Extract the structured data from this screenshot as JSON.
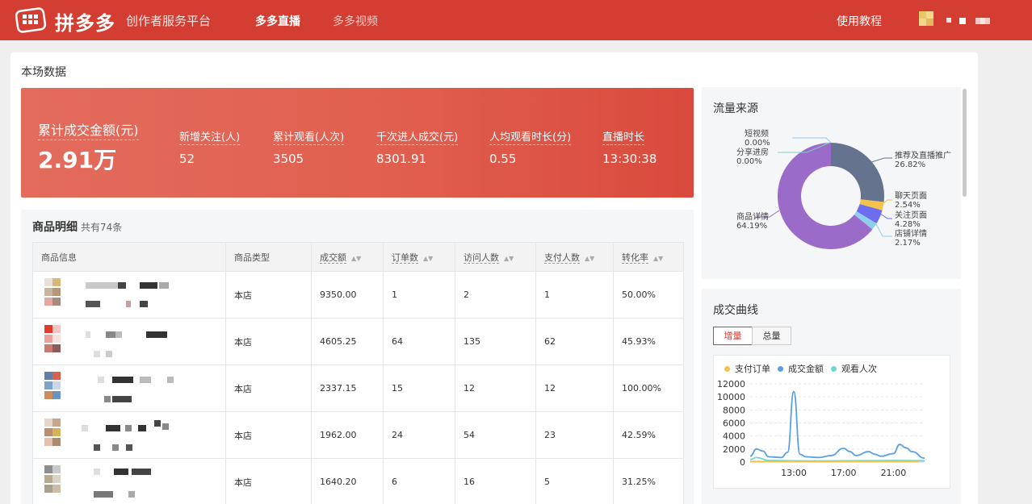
{
  "header": {
    "logo_text": "拼多多",
    "platform_name": "创作者服务平台",
    "nav": [
      {
        "label": "多多直播",
        "active": true
      },
      {
        "label": "多多视频",
        "active": false
      }
    ],
    "help_label": "使用教程",
    "icons": {
      "logo": "pinduoduo-logo-icon",
      "avatar": "user-avatar-icon"
    },
    "colors": {
      "brand": "#d43d32"
    }
  },
  "live_data": {
    "title": "本场数据",
    "total": {
      "label": "累计成交金额(元)",
      "value": "2.91万"
    },
    "metrics": [
      {
        "label": "新增关注(人)",
        "value": "52"
      },
      {
        "label": "累计观看(人次)",
        "value": "3505"
      },
      {
        "label": "千次进人成交(元)",
        "value": "8301.91"
      },
      {
        "label": "人均观看时长(分)",
        "value": "0.55"
      },
      {
        "label": "直播时长",
        "value": "13:30:38"
      }
    ]
  },
  "products": {
    "title": "商品明细",
    "count_text": "共有74条",
    "columns": [
      "商品信息",
      "商品类型",
      "成交额",
      "订单数",
      "访问人数",
      "支付人数",
      "转化率"
    ],
    "rows": [
      {
        "type": "本店",
        "amount": "9350.00",
        "orders": "1",
        "visitors": "2",
        "payers": "1",
        "rate": "50.00%"
      },
      {
        "type": "本店",
        "amount": "4605.25",
        "orders": "64",
        "visitors": "135",
        "payers": "62",
        "rate": "45.93%"
      },
      {
        "type": "本店",
        "amount": "2337.15",
        "orders": "15",
        "visitors": "12",
        "payers": "12",
        "rate": "100.00%"
      },
      {
        "type": "本店",
        "amount": "1962.00",
        "orders": "24",
        "visitors": "54",
        "payers": "23",
        "rate": "42.59%"
      },
      {
        "type": "本店",
        "amount": "1640.20",
        "orders": "6",
        "visitors": "16",
        "payers": "5",
        "rate": "31.25%"
      }
    ]
  },
  "traffic": {
    "title": "流量来源",
    "labels": {
      "short_video": {
        "name": "短视频",
        "pct": "0.00%"
      },
      "share": {
        "name": "分享进房",
        "pct": "0.00%"
      },
      "recommend": {
        "name": "推荐及直播推广",
        "pct": "26.82%"
      },
      "chat": {
        "name": "聊天页面",
        "pct": "2.54%"
      },
      "follow": {
        "name": "关注页面",
        "pct": "4.28%"
      },
      "shop": {
        "name": "店铺详情",
        "pct": "2.17%"
      },
      "product": {
        "name": "商品详情",
        "pct": "64.19%"
      }
    }
  },
  "curve": {
    "title": "成交曲线",
    "tabs": [
      {
        "label": "增量",
        "active": true
      },
      {
        "label": "总量",
        "active": false
      }
    ]
  },
  "chart_data": [
    {
      "type": "pie",
      "title": "流量来源",
      "donut": true,
      "slices": [
        {
          "name": "短视频",
          "value": 0.0,
          "color": "#9ec7e8"
        },
        {
          "name": "分享进房",
          "value": 0.0,
          "color": "#7fd3b6"
        },
        {
          "name": "推荐及直播推广",
          "value": 26.82,
          "color": "#66738f"
        },
        {
          "name": "聊天页面",
          "value": 2.54,
          "color": "#f5c24c"
        },
        {
          "name": "关注页面",
          "value": 4.28,
          "color": "#6d6df0"
        },
        {
          "name": "店铺详情",
          "value": 2.17,
          "color": "#8ecff0"
        },
        {
          "name": "商品详情",
          "value": 64.19,
          "color": "#9b6bc9"
        }
      ]
    },
    {
      "type": "line",
      "legend": "top",
      "ylim": [
        0,
        12000
      ],
      "yticks": [
        0,
        2000,
        4000,
        6000,
        8000,
        10000,
        12000
      ],
      "xlim": [
        9.5,
        23.5
      ],
      "xticks": [
        "13:00",
        "17:00",
        "21:00"
      ],
      "series": [
        {
          "name": "支付订单",
          "color": "#f2c347",
          "points": [
            [
              9.5,
              100
            ],
            [
              11,
              80
            ],
            [
              13,
              120
            ],
            [
              15,
              90
            ],
            [
              17,
              110
            ],
            [
              19,
              90
            ],
            [
              21,
              100
            ],
            [
              23,
              80
            ]
          ]
        },
        {
          "name": "成交金额",
          "color": "#5aa0e6",
          "points": [
            [
              9.5,
              900
            ],
            [
              10,
              2000
            ],
            [
              10.5,
              1700
            ],
            [
              11,
              800
            ],
            [
              12,
              700
            ],
            [
              12.5,
              1500
            ],
            [
              13,
              10800
            ],
            [
              13.5,
              1200
            ],
            [
              14,
              800
            ],
            [
              15,
              700
            ],
            [
              16,
              1000
            ],
            [
              17,
              2100
            ],
            [
              17.5,
              1600
            ],
            [
              18,
              1000
            ],
            [
              19,
              1600
            ],
            [
              19.5,
              1200
            ],
            [
              20,
              900
            ],
            [
              21,
              1300
            ],
            [
              21.5,
              2700
            ],
            [
              22,
              2200
            ],
            [
              22.5,
              1600
            ],
            [
              23.5,
              600
            ]
          ]
        },
        {
          "name": "观看人次",
          "color": "#6fd6d2",
          "points": [
            [
              9.5,
              400
            ],
            [
              10,
              700
            ],
            [
              11,
              250
            ],
            [
              13,
              200
            ],
            [
              15,
              180
            ],
            [
              17,
              200
            ],
            [
              19,
              220
            ],
            [
              21,
              250
            ],
            [
              23.5,
              200
            ]
          ]
        }
      ]
    }
  ]
}
